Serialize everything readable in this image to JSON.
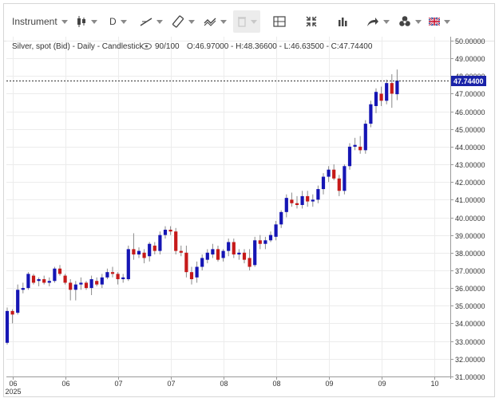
{
  "toolbar": {
    "instrument_label": "Instrument",
    "period_label": "D",
    "icons": [
      "candlestick-icon",
      "trendline-icon",
      "ruler-icon",
      "wave-icon",
      "trash-icon",
      "crosshair-icon",
      "fullscreen-icon",
      "volume-bars-icon",
      "share-arrow-icon",
      "settings-icon",
      "flag-uk-icon"
    ]
  },
  "legend": {
    "title": "Silver, spot (Bid) - Daily - Candlestick",
    "zoom": "90/100",
    "ohlc": "O:46.97000 - H:48.36600 - L:46.63500 - C:47.74400"
  },
  "current_price_label": "47.74400",
  "colors": {
    "up": "#1515b4",
    "down": "#c61a1a",
    "price_tag": "#1a23a8",
    "grid": "#ececec"
  },
  "chart_data": {
    "type": "candlestick",
    "title": "Silver, spot (Bid) - Daily - Candlestick",
    "ylim": [
      30.8,
      50.4
    ],
    "y_ticks": [
      "50.00000",
      "49.00000",
      "48.00000",
      "47.00000",
      "46.00000",
      "45.00000",
      "44.00000",
      "43.00000",
      "42.00000",
      "41.00000",
      "40.00000",
      "39.00000",
      "38.00000",
      "37.00000",
      "36.00000",
      "35.00000",
      "34.00000",
      "33.00000",
      "32.00000",
      "31.00000"
    ],
    "x_ticks": [
      {
        "label": "06",
        "sub": "2025",
        "index": 1
      },
      {
        "label": "06",
        "index": 11
      },
      {
        "label": "07",
        "index": 21
      },
      {
        "label": "07",
        "index": 31
      },
      {
        "label": "08",
        "index": 41
      },
      {
        "label": "08",
        "index": 51
      },
      {
        "label": "09",
        "index": 61
      },
      {
        "label": "09",
        "index": 71
      },
      {
        "label": "10",
        "index": 81
      }
    ],
    "ohlc": [
      {
        "o": 32.9,
        "h": 34.9,
        "l": 32.8,
        "c": 34.7
      },
      {
        "o": 34.7,
        "h": 34.8,
        "l": 34.0,
        "c": 34.5
      },
      {
        "o": 34.6,
        "h": 36.2,
        "l": 34.5,
        "c": 35.9
      },
      {
        "o": 35.9,
        "h": 36.3,
        "l": 35.7,
        "c": 36.0
      },
      {
        "o": 36.0,
        "h": 36.9,
        "l": 35.9,
        "c": 36.8
      },
      {
        "o": 36.7,
        "h": 36.8,
        "l": 36.2,
        "c": 36.3
      },
      {
        "o": 36.4,
        "h": 36.6,
        "l": 36.1,
        "c": 36.5
      },
      {
        "o": 36.5,
        "h": 36.7,
        "l": 36.2,
        "c": 36.3
      },
      {
        "o": 36.3,
        "h": 36.6,
        "l": 36.1,
        "c": 36.4
      },
      {
        "o": 36.4,
        "h": 37.2,
        "l": 36.3,
        "c": 37.1
      },
      {
        "o": 37.1,
        "h": 37.3,
        "l": 36.7,
        "c": 36.8
      },
      {
        "o": 36.7,
        "h": 36.8,
        "l": 36.2,
        "c": 36.3
      },
      {
        "o": 36.3,
        "h": 36.5,
        "l": 35.3,
        "c": 35.9
      },
      {
        "o": 35.9,
        "h": 36.4,
        "l": 35.3,
        "c": 36.2
      },
      {
        "o": 36.2,
        "h": 36.6,
        "l": 35.9,
        "c": 36.3
      },
      {
        "o": 36.3,
        "h": 36.4,
        "l": 35.9,
        "c": 36.0
      },
      {
        "o": 36.0,
        "h": 36.7,
        "l": 35.6,
        "c": 36.5
      },
      {
        "o": 36.4,
        "h": 36.6,
        "l": 36.1,
        "c": 36.2
      },
      {
        "o": 36.2,
        "h": 36.8,
        "l": 36.0,
        "c": 36.6
      },
      {
        "o": 36.6,
        "h": 37.1,
        "l": 36.5,
        "c": 36.9
      },
      {
        "o": 36.9,
        "h": 37.2,
        "l": 36.6,
        "c": 36.8
      },
      {
        "o": 36.8,
        "h": 36.9,
        "l": 36.2,
        "c": 36.5
      },
      {
        "o": 36.5,
        "h": 36.8,
        "l": 36.3,
        "c": 36.6
      },
      {
        "o": 36.5,
        "h": 38.4,
        "l": 36.4,
        "c": 38.2
      },
      {
        "o": 38.2,
        "h": 39.1,
        "l": 37.6,
        "c": 37.9
      },
      {
        "o": 37.9,
        "h": 38.3,
        "l": 37.7,
        "c": 38.1
      },
      {
        "o": 38.0,
        "h": 38.2,
        "l": 37.4,
        "c": 37.7
      },
      {
        "o": 37.8,
        "h": 38.6,
        "l": 37.5,
        "c": 38.5
      },
      {
        "o": 38.4,
        "h": 38.6,
        "l": 37.9,
        "c": 38.1
      },
      {
        "o": 38.1,
        "h": 39.2,
        "l": 37.9,
        "c": 39.0
      },
      {
        "o": 39.0,
        "h": 39.5,
        "l": 38.8,
        "c": 39.3
      },
      {
        "o": 39.3,
        "h": 39.5,
        "l": 39.0,
        "c": 39.2
      },
      {
        "o": 39.2,
        "h": 39.4,
        "l": 37.9,
        "c": 38.1
      },
      {
        "o": 38.1,
        "h": 38.4,
        "l": 37.8,
        "c": 38.0
      },
      {
        "o": 38.0,
        "h": 38.4,
        "l": 36.6,
        "c": 36.9
      },
      {
        "o": 36.9,
        "h": 37.2,
        "l": 36.2,
        "c": 36.5
      },
      {
        "o": 36.6,
        "h": 37.5,
        "l": 36.3,
        "c": 37.2
      },
      {
        "o": 37.2,
        "h": 37.9,
        "l": 37.0,
        "c": 37.7
      },
      {
        "o": 37.6,
        "h": 38.2,
        "l": 37.4,
        "c": 38.0
      },
      {
        "o": 37.9,
        "h": 38.5,
        "l": 37.7,
        "c": 38.2
      },
      {
        "o": 38.2,
        "h": 38.4,
        "l": 37.5,
        "c": 37.6
      },
      {
        "o": 37.7,
        "h": 38.2,
        "l": 37.5,
        "c": 38.1
      },
      {
        "o": 38.1,
        "h": 38.8,
        "l": 37.8,
        "c": 38.6
      },
      {
        "o": 38.6,
        "h": 38.8,
        "l": 37.7,
        "c": 37.9
      },
      {
        "o": 37.9,
        "h": 38.2,
        "l": 37.6,
        "c": 38.0
      },
      {
        "o": 38.0,
        "h": 38.2,
        "l": 37.4,
        "c": 37.6
      },
      {
        "o": 37.7,
        "h": 38.2,
        "l": 37.0,
        "c": 37.2
      },
      {
        "o": 37.3,
        "h": 38.9,
        "l": 37.2,
        "c": 38.7
      },
      {
        "o": 38.7,
        "h": 39.0,
        "l": 38.2,
        "c": 38.5
      },
      {
        "o": 38.5,
        "h": 38.9,
        "l": 38.2,
        "c": 38.7
      },
      {
        "o": 38.7,
        "h": 39.2,
        "l": 38.6,
        "c": 39.0
      },
      {
        "o": 38.9,
        "h": 39.8,
        "l": 38.7,
        "c": 39.6
      },
      {
        "o": 39.6,
        "h": 40.4,
        "l": 39.4,
        "c": 40.3
      },
      {
        "o": 40.3,
        "h": 41.3,
        "l": 40.0,
        "c": 41.1
      },
      {
        "o": 41.0,
        "h": 41.4,
        "l": 40.6,
        "c": 40.8
      },
      {
        "o": 40.8,
        "h": 41.2,
        "l": 40.5,
        "c": 40.7
      },
      {
        "o": 40.7,
        "h": 41.5,
        "l": 40.5,
        "c": 41.2
      },
      {
        "o": 41.2,
        "h": 41.5,
        "l": 40.6,
        "c": 40.9
      },
      {
        "o": 40.9,
        "h": 41.3,
        "l": 40.6,
        "c": 41.0
      },
      {
        "o": 41.0,
        "h": 41.8,
        "l": 40.8,
        "c": 41.6
      },
      {
        "o": 41.6,
        "h": 42.5,
        "l": 41.3,
        "c": 42.3
      },
      {
        "o": 42.3,
        "h": 42.9,
        "l": 42.0,
        "c": 42.7
      },
      {
        "o": 42.7,
        "h": 43.0,
        "l": 42.1,
        "c": 42.2
      },
      {
        "o": 42.2,
        "h": 42.4,
        "l": 41.2,
        "c": 41.5
      },
      {
        "o": 41.5,
        "h": 43.0,
        "l": 41.3,
        "c": 42.9
      },
      {
        "o": 42.9,
        "h": 44.2,
        "l": 42.7,
        "c": 44.0
      },
      {
        "o": 44.0,
        "h": 44.5,
        "l": 43.8,
        "c": 44.1
      },
      {
        "o": 44.0,
        "h": 44.6,
        "l": 43.6,
        "c": 43.8
      },
      {
        "o": 43.8,
        "h": 45.5,
        "l": 43.6,
        "c": 45.3
      },
      {
        "o": 45.3,
        "h": 46.6,
        "l": 45.1,
        "c": 46.4
      },
      {
        "o": 46.3,
        "h": 47.3,
        "l": 45.9,
        "c": 47.1
      },
      {
        "o": 47.0,
        "h": 47.4,
        "l": 46.3,
        "c": 46.6
      },
      {
        "o": 46.6,
        "h": 47.8,
        "l": 46.4,
        "c": 47.6
      },
      {
        "o": 47.6,
        "h": 48.1,
        "l": 46.2,
        "c": 47.0
      },
      {
        "o": 46.97,
        "h": 48.366,
        "l": 46.635,
        "c": 47.744
      }
    ]
  }
}
